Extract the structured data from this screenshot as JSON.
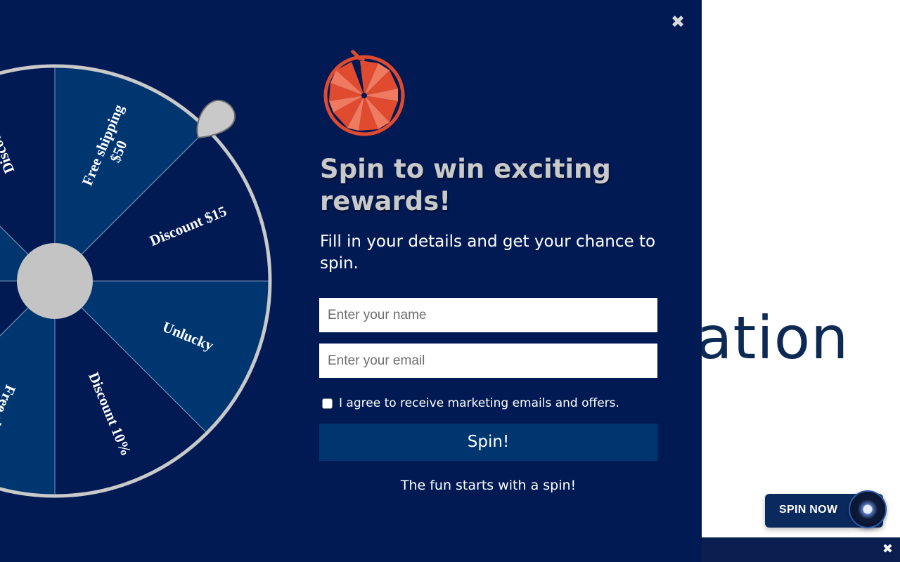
{
  "background_page": {
    "heading_fragment": "ation"
  },
  "floating_button": {
    "label": "SPIN NOW"
  },
  "bottom_bar": {
    "close_glyph": "✖"
  },
  "popup": {
    "close_glyph": "✖",
    "title": "Spin to win exciting rewards!",
    "subtitle": "Fill in your details and get your chance to spin.",
    "name_placeholder": "Enter your name",
    "email_placeholder": "Enter your email",
    "consent_label": "I agree to receive marketing emails and offers.",
    "consent_checked": false,
    "spin_button": "Spin!",
    "footer": "The fun starts with a spin!"
  },
  "wheel": {
    "segments": [
      {
        "label": "Free shipping\n$50",
        "color": "#003670"
      },
      {
        "label": "Discount $15",
        "color": "#021a54"
      },
      {
        "label": "Unlucky",
        "color": "#003670"
      },
      {
        "label": "Discount 10%",
        "color": "#021a54"
      },
      {
        "label": "Free shi...",
        "color": "#003670"
      },
      {
        "label": "",
        "color": "#021a54"
      },
      {
        "label": "",
        "color": "#003670"
      },
      {
        "label": "Discou...",
        "color": "#021a54"
      }
    ],
    "rim_color": "#c9c9c9",
    "hub_color": "#c4c4c4"
  },
  "colors": {
    "panel": "#021a54",
    "accent": "#003670",
    "logo": "#e04a2e"
  }
}
